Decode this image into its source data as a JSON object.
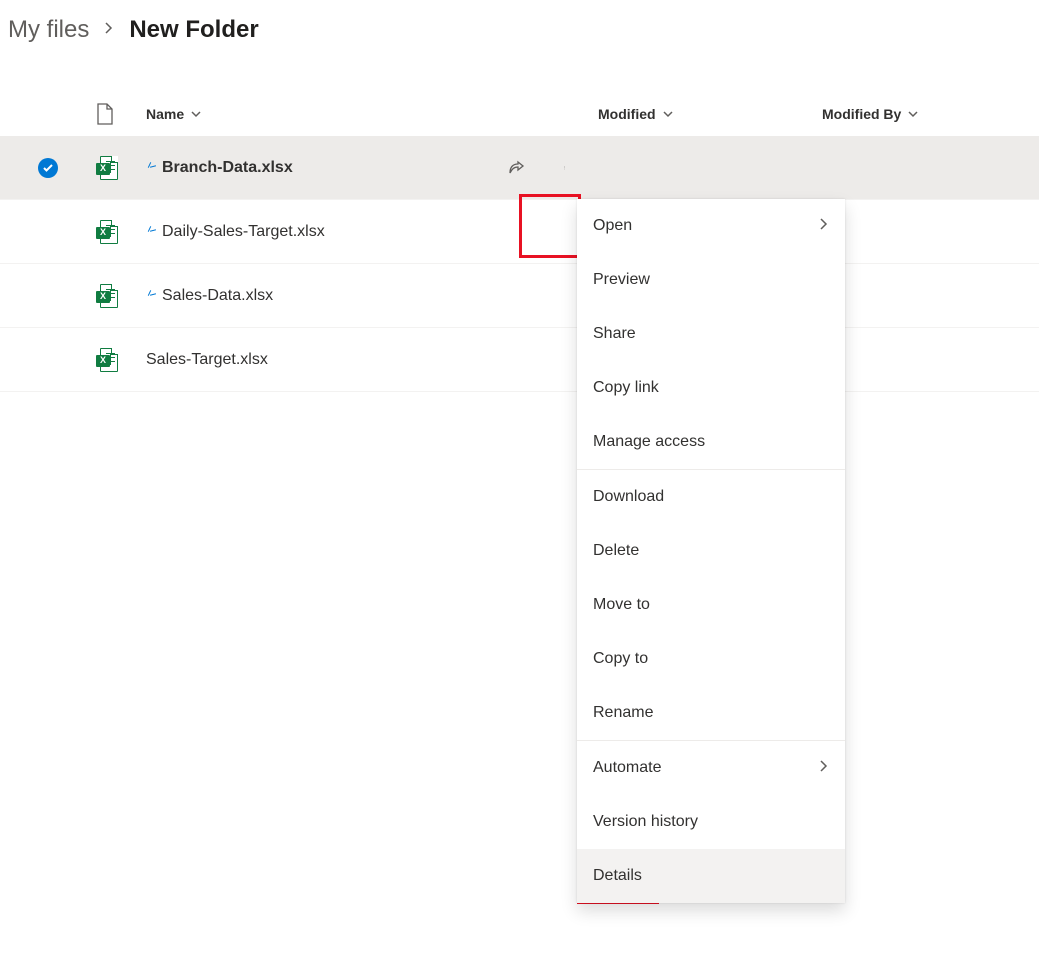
{
  "breadcrumb": {
    "root": "My files",
    "current": "New Folder"
  },
  "columns": {
    "name": "Name",
    "modified": "Modified",
    "modified_by": "Modified By"
  },
  "files": [
    {
      "name": "Branch-Data.xlsx",
      "selected": true,
      "is_new": true
    },
    {
      "name": "Daily-Sales-Target.xlsx",
      "selected": false,
      "is_new": true
    },
    {
      "name": "Sales-Data.xlsx",
      "selected": false,
      "is_new": true
    },
    {
      "name": "Sales-Target.xlsx",
      "selected": false,
      "is_new": false
    }
  ],
  "menu": {
    "groups": [
      [
        {
          "label": "Open",
          "submenu": true
        },
        {
          "label": "Preview",
          "submenu": false
        },
        {
          "label": "Share",
          "submenu": false
        },
        {
          "label": "Copy link",
          "submenu": false
        },
        {
          "label": "Manage access",
          "submenu": false
        }
      ],
      [
        {
          "label": "Download",
          "submenu": false
        },
        {
          "label": "Delete",
          "submenu": false
        },
        {
          "label": "Move to",
          "submenu": false
        },
        {
          "label": "Copy to",
          "submenu": false
        },
        {
          "label": "Rename",
          "submenu": false
        }
      ],
      [
        {
          "label": "Automate",
          "submenu": true
        },
        {
          "label": "Version history",
          "submenu": false
        },
        {
          "label": "Details",
          "submenu": false,
          "hover": true
        }
      ]
    ]
  }
}
